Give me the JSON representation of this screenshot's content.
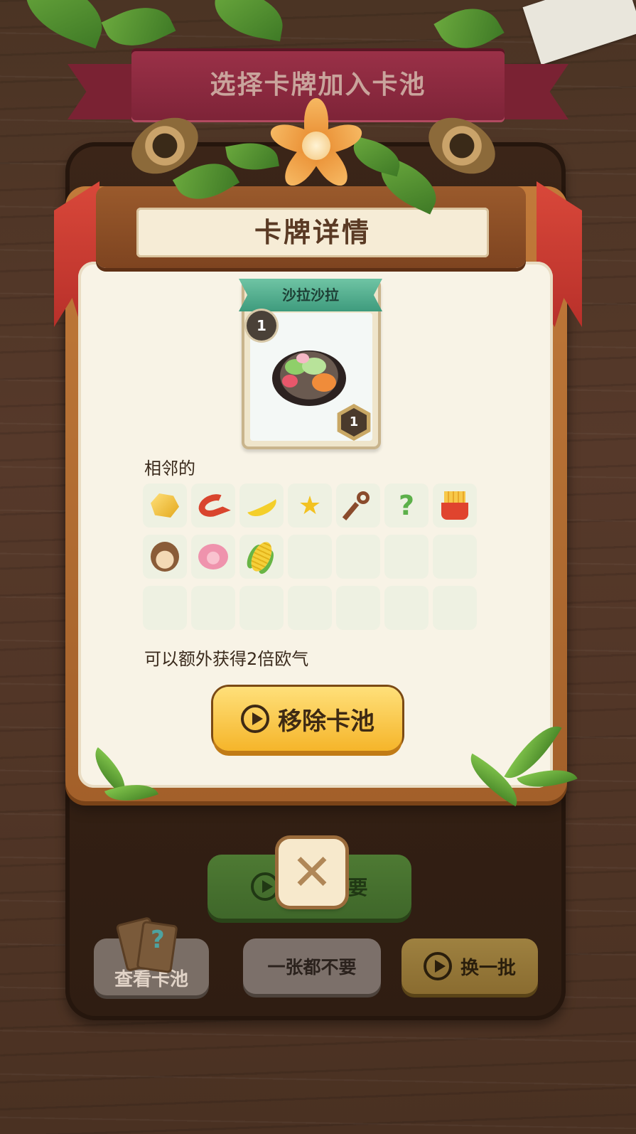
{
  "top_banner": {
    "title": "选择卡牌加入卡池"
  },
  "detail_header": {
    "title": "卡牌详情"
  },
  "card": {
    "name": "沙拉沙拉",
    "cost_badge": "1",
    "level_badge": "1",
    "art": "salad-plate"
  },
  "adjacent": {
    "label": "相邻的",
    "items": [
      "gold-nugget",
      "shrimp",
      "banana",
      "star",
      "key",
      "sprout",
      "fries",
      "monkey",
      "pig",
      "corn",
      "",
      "",
      "",
      "",
      "",
      "",
      "",
      "",
      "",
      "",
      ""
    ]
  },
  "effect_text": "可以额外获得2倍欧气",
  "buttons": {
    "remove": "移除卡池",
    "take_all": "我全都要",
    "view_pool": "查看卡池",
    "none": "一张都不要",
    "swap": "换一批",
    "close": "✕"
  },
  "colors": {
    "background": "#4b3424",
    "banner": "#8a2a3f",
    "panel": "#f8f3e6",
    "remove_button": "#f5c93e",
    "take_all_button": "#4e7a33",
    "swap_button": "#9e8140"
  }
}
